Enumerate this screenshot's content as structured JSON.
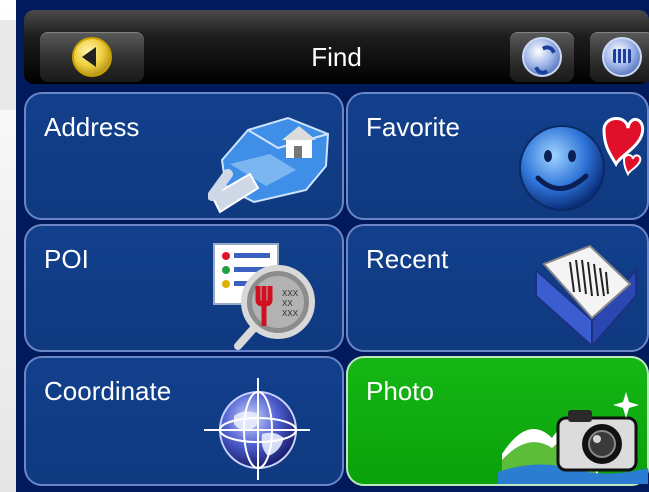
{
  "header": {
    "title": "Find"
  },
  "tiles": [
    {
      "label": "Address",
      "icon": "address-map-icon"
    },
    {
      "label": "Favorite",
      "icon": "favorite-smiley-heart-icon"
    },
    {
      "label": "POI",
      "icon": "poi-magnifier-icon"
    },
    {
      "label": "Recent",
      "icon": "recent-book-icon"
    },
    {
      "label": "Coordinate",
      "icon": "coordinate-globe-icon"
    },
    {
      "label": "Photo",
      "icon": "photo-camera-icon",
      "selected": true
    }
  ],
  "colors": {
    "tile": "#123f8c",
    "tile_border": "#6b86c6",
    "selected": "#10b010",
    "screen": "#001a5c"
  }
}
